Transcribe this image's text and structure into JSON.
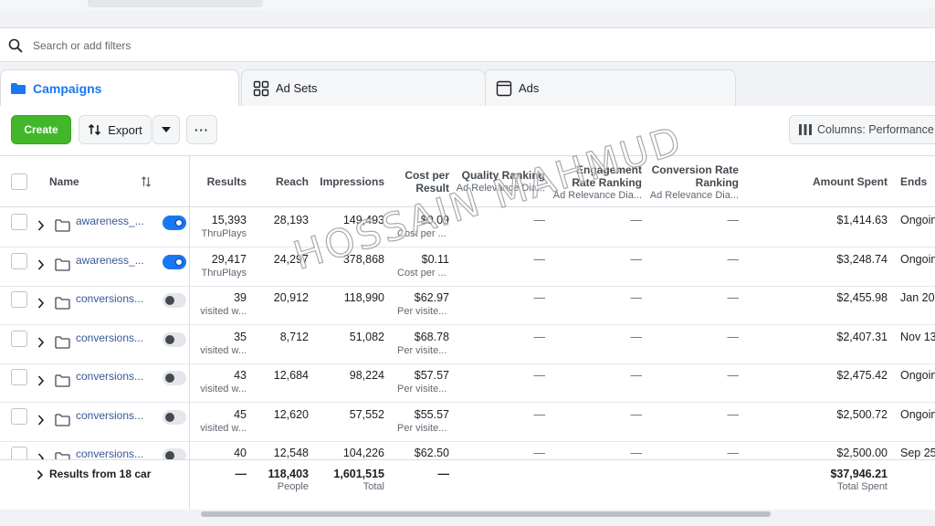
{
  "search": {
    "placeholder": "Search or add filters"
  },
  "tabs": [
    {
      "label": "Campaigns",
      "active": true,
      "icon": "folder-icon"
    },
    {
      "label": "Ad Sets",
      "active": false,
      "icon": "grid-icon"
    },
    {
      "label": "Ads",
      "active": false,
      "icon": "ad-window-icon"
    }
  ],
  "toolbar": {
    "create_label": "Create",
    "export_label": "Export",
    "more_label": "···",
    "columns_label": "Columns: Performance"
  },
  "columns": {
    "name": "Name",
    "results": "Results",
    "reach": "Reach",
    "impressions": "Impressions",
    "cost_per_result": [
      "Cost per",
      "Result"
    ],
    "quality_ranking": "Quality Ranking",
    "quality_ranking_sub": "Ad Relevance Dia...",
    "engagement_ranking": [
      "Engagement",
      "Rate Ranking"
    ],
    "engagement_ranking_sub": "Ad Relevance Dia...",
    "conversion_ranking": [
      "Conversion Rate",
      "Ranking"
    ],
    "conversion_ranking_sub": "Ad Relevance Dia...",
    "amount_spent": "Amount Spent",
    "ends": "Ends"
  },
  "rows": [
    {
      "name": "awareness_...",
      "active": true,
      "results": "15,393",
      "results_sub": "ThruPlays",
      "reach": "28,193",
      "impressions": "149,493",
      "cost": "$0.09",
      "cost_sub": "Cost per ...",
      "quality": "—",
      "engagement": "—",
      "conversion": "—",
      "spent": "$1,414.63",
      "ends": "Ongoin"
    },
    {
      "name": "awareness_...",
      "active": true,
      "results": "29,417",
      "results_sub": "ThruPlays",
      "reach": "24,297",
      "impressions": "378,868",
      "cost": "$0.11",
      "cost_sub": "Cost per ...",
      "quality": "—",
      "engagement": "—",
      "conversion": "—",
      "spent": "$3,248.74",
      "ends": "Ongoin"
    },
    {
      "name": "conversions...",
      "active": false,
      "results": "39",
      "results_sub": "visited w...",
      "reach": "20,912",
      "impressions": "118,990",
      "cost": "$62.97",
      "cost_sub": "Per visite...",
      "quality": "—",
      "engagement": "—",
      "conversion": "—",
      "spent": "$2,455.98",
      "ends": "Jan 20"
    },
    {
      "name": "conversions...",
      "active": false,
      "results": "35",
      "results_sub": "visited w...",
      "reach": "8,712",
      "impressions": "51,082",
      "cost": "$68.78",
      "cost_sub": "Per visite...",
      "quality": "—",
      "engagement": "—",
      "conversion": "—",
      "spent": "$2,407.31",
      "ends": "Nov 13"
    },
    {
      "name": "conversions...",
      "active": false,
      "results": "43",
      "results_sub": "visited w...",
      "reach": "12,684",
      "impressions": "98,224",
      "cost": "$57.57",
      "cost_sub": "Per visite...",
      "quality": "—",
      "engagement": "—",
      "conversion": "—",
      "spent": "$2,475.42",
      "ends": "Ongoin"
    },
    {
      "name": "conversions...",
      "active": false,
      "results": "45",
      "results_sub": "visited w...",
      "reach": "12,620",
      "impressions": "57,552",
      "cost": "$55.57",
      "cost_sub": "Per visite...",
      "quality": "—",
      "engagement": "—",
      "conversion": "—",
      "spent": "$2,500.72",
      "ends": "Ongoin"
    },
    {
      "name": "conversions...",
      "active": false,
      "results": "40",
      "results_sub": "",
      "reach": "12,548",
      "impressions": "104,226",
      "cost": "$62.50",
      "cost_sub": "",
      "quality": "—",
      "engagement": "—",
      "conversion": "—",
      "spent": "$2,500.00",
      "ends": "Sep 25"
    }
  ],
  "footer": {
    "label": "Results from 18 car",
    "results": "—",
    "reach": "118,403",
    "reach_sub": "People",
    "impressions": "1,601,515",
    "impressions_sub": "Total",
    "cost": "—",
    "spent": "$37,946.21",
    "spent_sub": "Total Spent"
  },
  "watermark": "HOSSAIN MAHMUD",
  "colors": {
    "accent": "#1877f2",
    "create": "#42b72a",
    "link": "#385898"
  }
}
